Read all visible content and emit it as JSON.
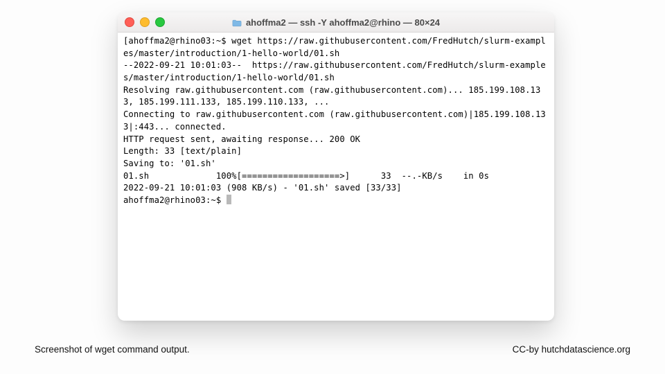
{
  "window": {
    "title": "ahoffma2 — ssh -Y ahoffma2@rhino — 80×24"
  },
  "terminal": {
    "lines": [
      "[ahoffma2@rhino03:~$ wget https://raw.githubusercontent.com/FredHutch/slurm-examples/master/introduction/1-hello-world/01.sh",
      "--2022-09-21 10:01:03--  https://raw.githubusercontent.com/FredHutch/slurm-examples/master/introduction/1-hello-world/01.sh",
      "Resolving raw.githubusercontent.com (raw.githubusercontent.com)... 185.199.108.133, 185.199.111.133, 185.199.110.133, ...",
      "Connecting to raw.githubusercontent.com (raw.githubusercontent.com)|185.199.108.133|:443... connected.",
      "HTTP request sent, awaiting response... 200 OK",
      "Length: 33 [text/plain]",
      "Saving to: '01.sh'",
      "",
      "01.sh             100%[===================>]      33  --.-KB/s    in 0s",
      "",
      "2022-09-21 10:01:03 (908 KB/s) - '01.sh' saved [33/33]",
      ""
    ],
    "prompt": "ahoffma2@rhino03:~$ "
  },
  "captions": {
    "left": "Screenshot of wget command output.",
    "right": "CC-by hutchdatascience.org"
  }
}
